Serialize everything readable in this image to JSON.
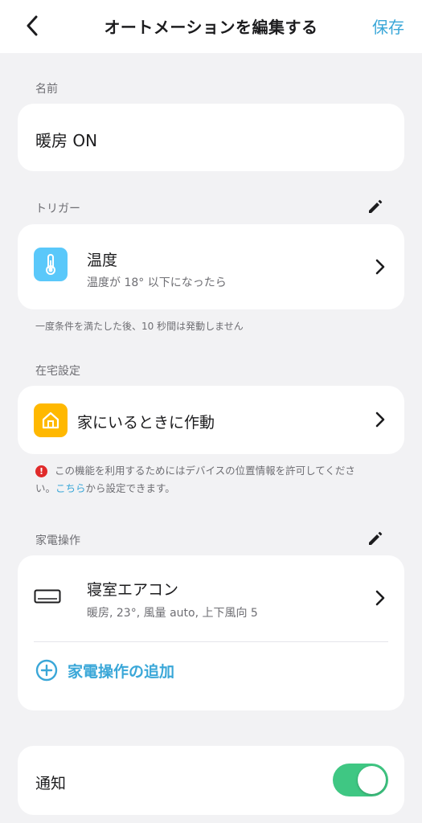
{
  "header": {
    "title": "オートメーションを編集する",
    "save_label": "保存"
  },
  "name_section": {
    "label": "名前",
    "value": "暖房 ON"
  },
  "trigger_section": {
    "label": "トリガー",
    "item": {
      "title": "温度",
      "subtitle": "温度が 18° 以下になったら",
      "icon": "thermometer-icon",
      "icon_color": "#5ac8fa"
    },
    "note": "一度条件を満たした後、10 秒間は発動しません"
  },
  "presence_section": {
    "label": "在宅設定",
    "item": {
      "title": "家にいるときに作動",
      "icon": "home-icon",
      "icon_color": "#ffb800"
    },
    "warning_part1": "この機能を利用するためにはデバイスの位置情報を許可してくださ",
    "warning_part2": "い。",
    "warning_link": "こちら",
    "warning_part3": "から設定できます。"
  },
  "appliance_section": {
    "label": "家電操作",
    "item": {
      "title": "寝室エアコン",
      "subtitle": "暖房, 23°, 風量 auto, 上下風向 5",
      "icon": "air-conditioner-icon"
    },
    "add_label": "家電操作の追加"
  },
  "notification_section": {
    "label": "通知",
    "enabled": true
  },
  "colors": {
    "accent": "#3aa7d8",
    "toggle_on": "#3fc783",
    "warning": "#e02a2a",
    "background": "#f2f2f4"
  }
}
